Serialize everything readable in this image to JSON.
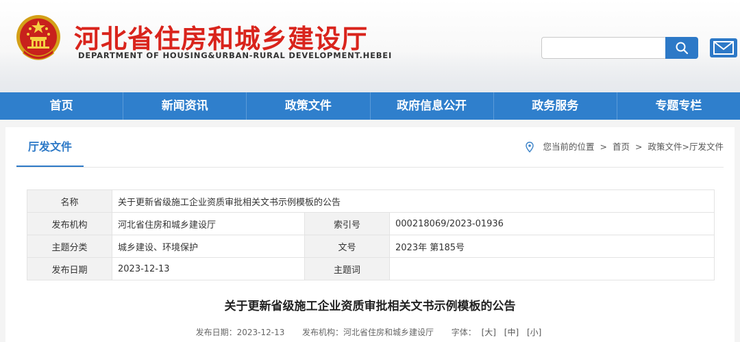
{
  "header": {
    "site_title": "河北省住房和城乡建设厅",
    "site_subtitle": "DEPARTMENT OF HOUSING&URBAN-RURAL DEVELOPMENT.HEBEI",
    "search_placeholder": "",
    "search_icon": "search-icon",
    "mail_icon": "mail-icon"
  },
  "nav": {
    "items": [
      {
        "label": "首页"
      },
      {
        "label": "新闻资讯"
      },
      {
        "label": "政策文件"
      },
      {
        "label": "政府信息公开"
      },
      {
        "label": "政务服务"
      },
      {
        "label": "专题专栏"
      }
    ]
  },
  "panel": {
    "tab_label": "厅发文件",
    "breadcrumb": {
      "current_position": "您当前的位置",
      "sep": ">",
      "home": "首页",
      "path": "政策文件>厅发文件"
    }
  },
  "info": {
    "name_label": "名称",
    "name_value": "关于更新省级施工企业资质审批相关文书示例模板的公告",
    "publisher_label": "发布机构",
    "publisher_value": "河北省住房和城乡建设厅",
    "index_label": "索引号",
    "index_value": "000218069/2023-01936",
    "category_label": "主题分类",
    "category_value": "城乡建设、环境保护",
    "docno_label": "文号",
    "docno_value": "2023年 第185号",
    "date_label": "发布日期",
    "date_value": "2023-12-13",
    "keywords_label": "主题词",
    "keywords_value": ""
  },
  "article": {
    "title": "关于更新省级施工企业资质审批相关文书示例模板的公告",
    "meta_date": "发布日期：2023-12-13",
    "meta_org": "发布机构：河北省住房和城乡建设厅",
    "meta_font_label": "字体：",
    "font_large": "[大]",
    "font_medium": "[中]",
    "font_small": "[小]"
  },
  "colors": {
    "brand_red": "#d9241c",
    "nav_blue": "#2f7fcc",
    "accent_blue": "#2d79c7"
  }
}
